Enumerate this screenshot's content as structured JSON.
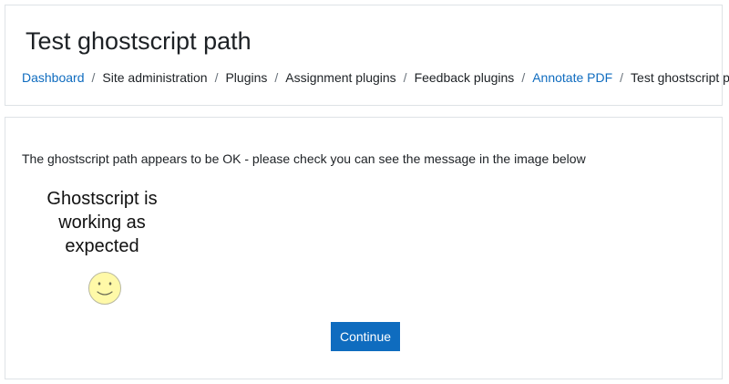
{
  "header": {
    "title": "Test ghostscript path",
    "breadcrumb": [
      {
        "label": "Dashboard",
        "link": true
      },
      {
        "label": "Site administration",
        "link": false
      },
      {
        "label": "Plugins",
        "link": false
      },
      {
        "label": "Assignment plugins",
        "link": false
      },
      {
        "label": "Feedback plugins",
        "link": false
      },
      {
        "label": "Annotate PDF",
        "link": true
      },
      {
        "label": "Test ghostscript path",
        "link": false
      }
    ],
    "separator": "/"
  },
  "main": {
    "message": "The ghostscript path appears to be OK - please check you can see the message in the image below",
    "image_text_lines": [
      "Ghostscript is",
      "working as",
      "expected"
    ],
    "image_icon": "smiley-face-icon",
    "continue_label": "Continue"
  },
  "colors": {
    "link": "#0f6cbf",
    "button": "#0f6cbf",
    "border": "#dee2e6",
    "smiley_fill": "#fff9a8"
  }
}
